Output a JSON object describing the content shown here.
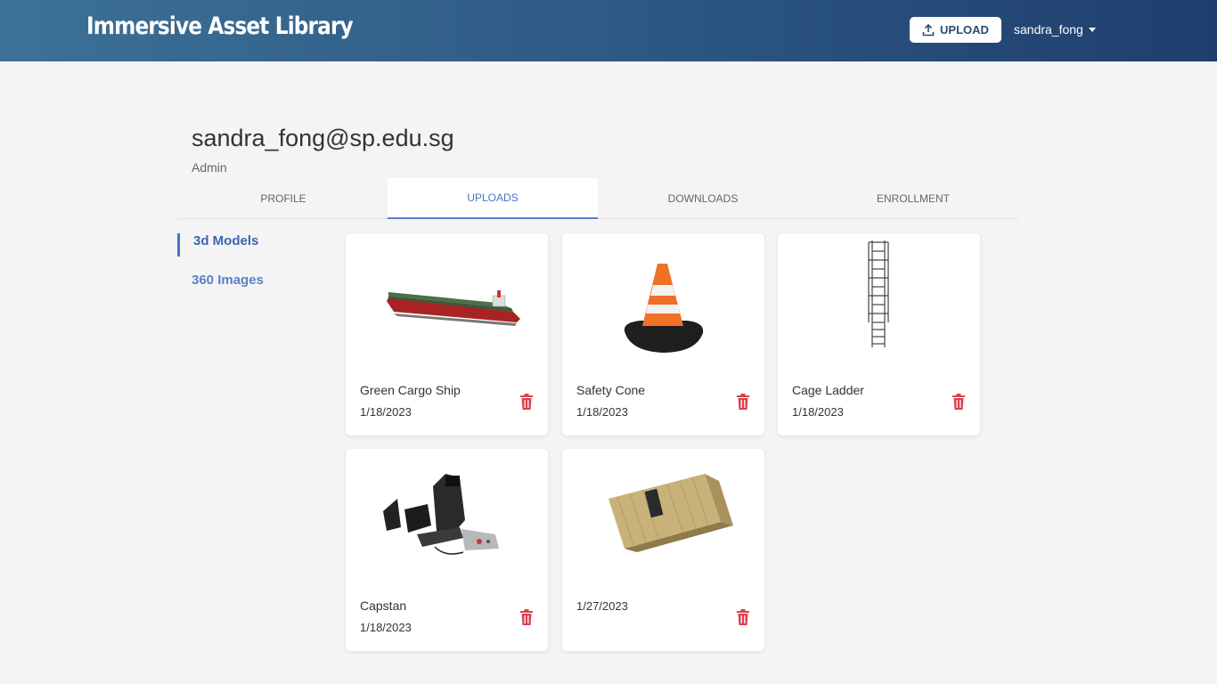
{
  "header": {
    "title": "Immersive Asset Library",
    "upload_label": "UPLOAD",
    "username": "sandra_fong"
  },
  "profile": {
    "email": "sandra_fong@sp.edu.sg",
    "role": "Admin"
  },
  "tabs": [
    {
      "label": "PROFILE",
      "active": false
    },
    {
      "label": "UPLOADS",
      "active": true
    },
    {
      "label": "DOWNLOADS",
      "active": false
    },
    {
      "label": "ENROLLMENT",
      "active": false
    }
  ],
  "sidebar": {
    "items": [
      {
        "label": "3d Models",
        "active": true
      },
      {
        "label": "360 Images",
        "active": false
      }
    ]
  },
  "assets": [
    {
      "name": "Green Cargo Ship",
      "date": "1/18/2023"
    },
    {
      "name": "Safety Cone",
      "date": "1/18/2023"
    },
    {
      "name": "Cage Ladder",
      "date": "1/18/2023"
    },
    {
      "name": "Capstan",
      "date": "1/18/2023"
    },
    {
      "name": "",
      "date": "1/27/2023"
    }
  ],
  "colors": {
    "accent": "#4a72c4",
    "delete": "#d9414d"
  }
}
